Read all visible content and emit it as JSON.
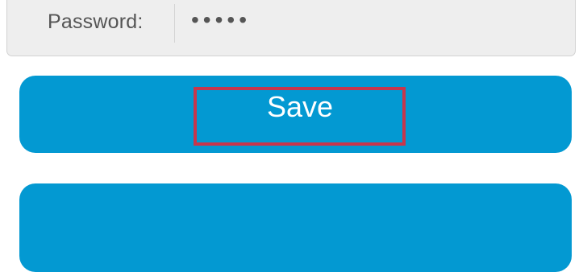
{
  "password_field": {
    "label": "Password:",
    "masked_value": "•••••"
  },
  "actions": {
    "save_label": "Save"
  },
  "colors": {
    "button_bg": "#0399d2",
    "panel_bg": "#eeeeee",
    "highlight_border": "#c7364c",
    "label_text": "#555555"
  }
}
